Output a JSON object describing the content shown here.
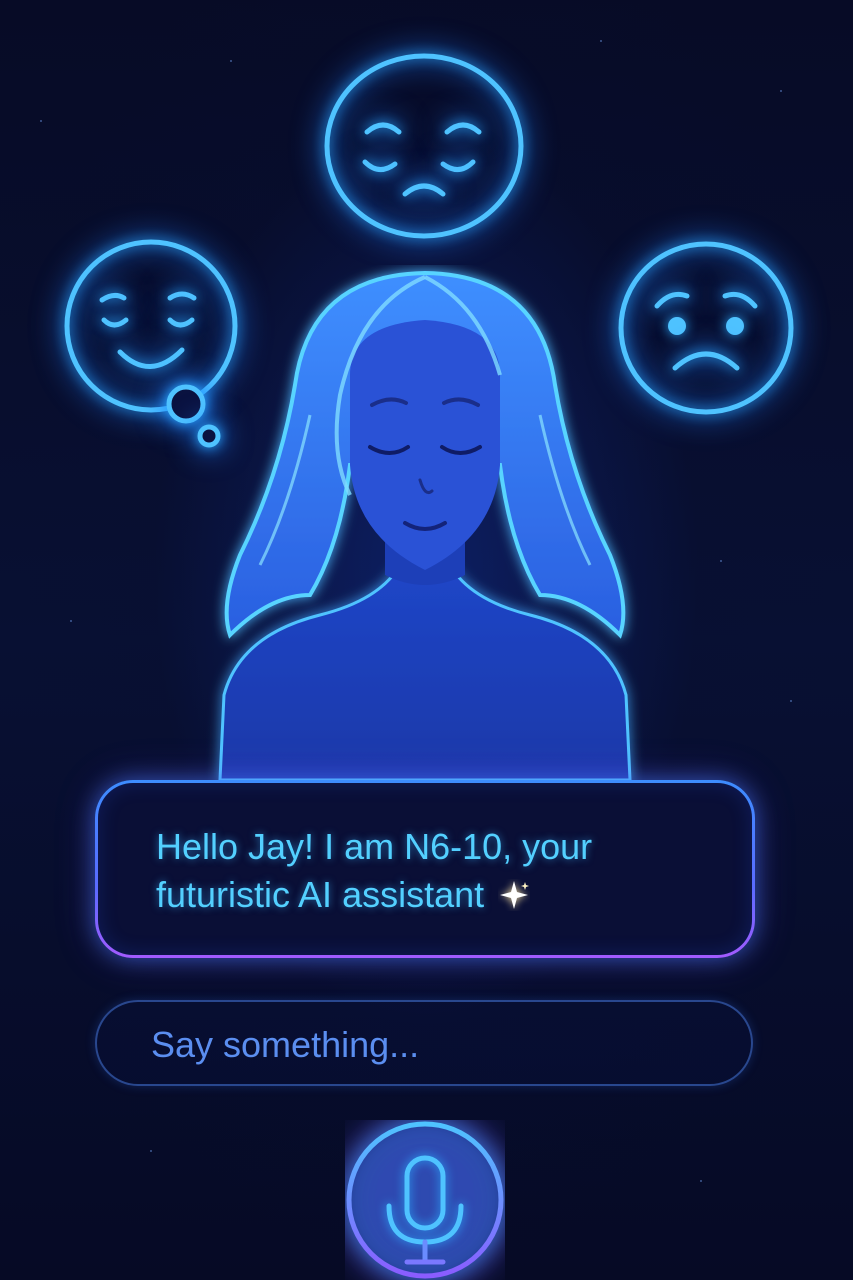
{
  "assistant": {
    "name": "N6-10",
    "greeting": "Hello Jay! I am N6-10, your futuristic AI assistant",
    "greeting_icon": "sparkle-icon"
  },
  "input": {
    "placeholder": "Say something..."
  },
  "mic": {
    "icon": "microphone-icon"
  },
  "emotions": {
    "icons": [
      "sad-face-icon",
      "happy-thinking-face-icon",
      "worried-face-icon"
    ]
  },
  "colors": {
    "background": "#070b26",
    "accent_cyan": "#4fc3ff",
    "text": "#53d0ff",
    "bubble_gradient_end": "#a25bff"
  }
}
